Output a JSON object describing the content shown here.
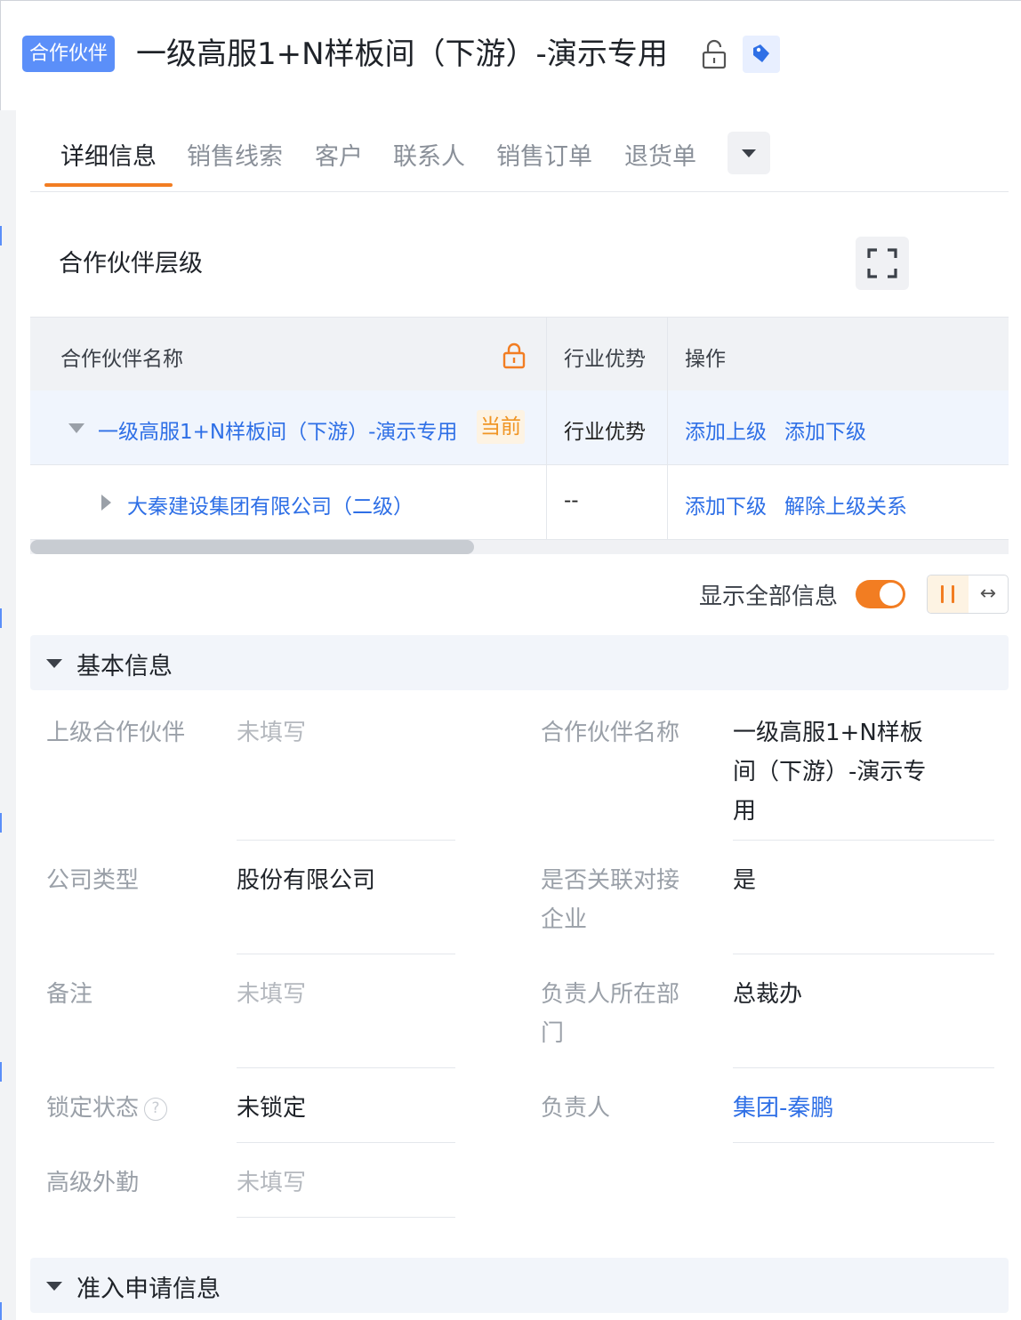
{
  "header": {
    "tag": "合作伙伴",
    "title": "一级高服1+N样板间（下游）-演示专用",
    "icons": [
      "lock-open-icon",
      "tag-icon"
    ]
  },
  "tabs": [
    "详细信息",
    "销售线索",
    "客户",
    "联系人",
    "销售订单",
    "退货单"
  ],
  "active_tab": "详细信息",
  "hierarchy": {
    "title": "合作伙伴层级",
    "columns": {
      "name": "合作伙伴名称",
      "industry": "行业优势",
      "action": "操作"
    },
    "rows": [
      {
        "name": "一级高服1+N样板间（下游）-演示专用",
        "badge": "当前",
        "industry": "行业优势",
        "actions": [
          "添加上级",
          "添加下级"
        ]
      },
      {
        "name": "大秦建设集团有限公司（二级）",
        "industry": "--",
        "actions": [
          "添加下级",
          "解除上级关系"
        ]
      }
    ]
  },
  "display_toggle": {
    "label": "显示全部信息",
    "on": true
  },
  "accent_color": "#f27d22",
  "link_color": "#2e6fe6",
  "basic_info": {
    "title": "基本信息",
    "fields": {
      "parent_partner": {
        "label": "上级合作伙伴",
        "value": "未填写"
      },
      "partner_name": {
        "label": "合作伙伴名称",
        "value": "一级高服1+N样板间（下游）-演示专用"
      },
      "company_type": {
        "label": "公司类型",
        "value": "股份有限公司"
      },
      "linked_enterprise": {
        "label": "是否关联对接企业",
        "value": "是"
      },
      "remark": {
        "label": "备注",
        "value": "未填写"
      },
      "owner_department": {
        "label": "负责人所在部门",
        "value": "总裁办"
      },
      "lock_status": {
        "label": "锁定状态",
        "value": "未锁定"
      },
      "owner": {
        "label": "负责人",
        "value": "集团-秦鹏"
      },
      "advanced_field": {
        "label": "高级外勤",
        "value": "未填写"
      }
    }
  },
  "admission_info": {
    "title": "准入申请信息"
  }
}
